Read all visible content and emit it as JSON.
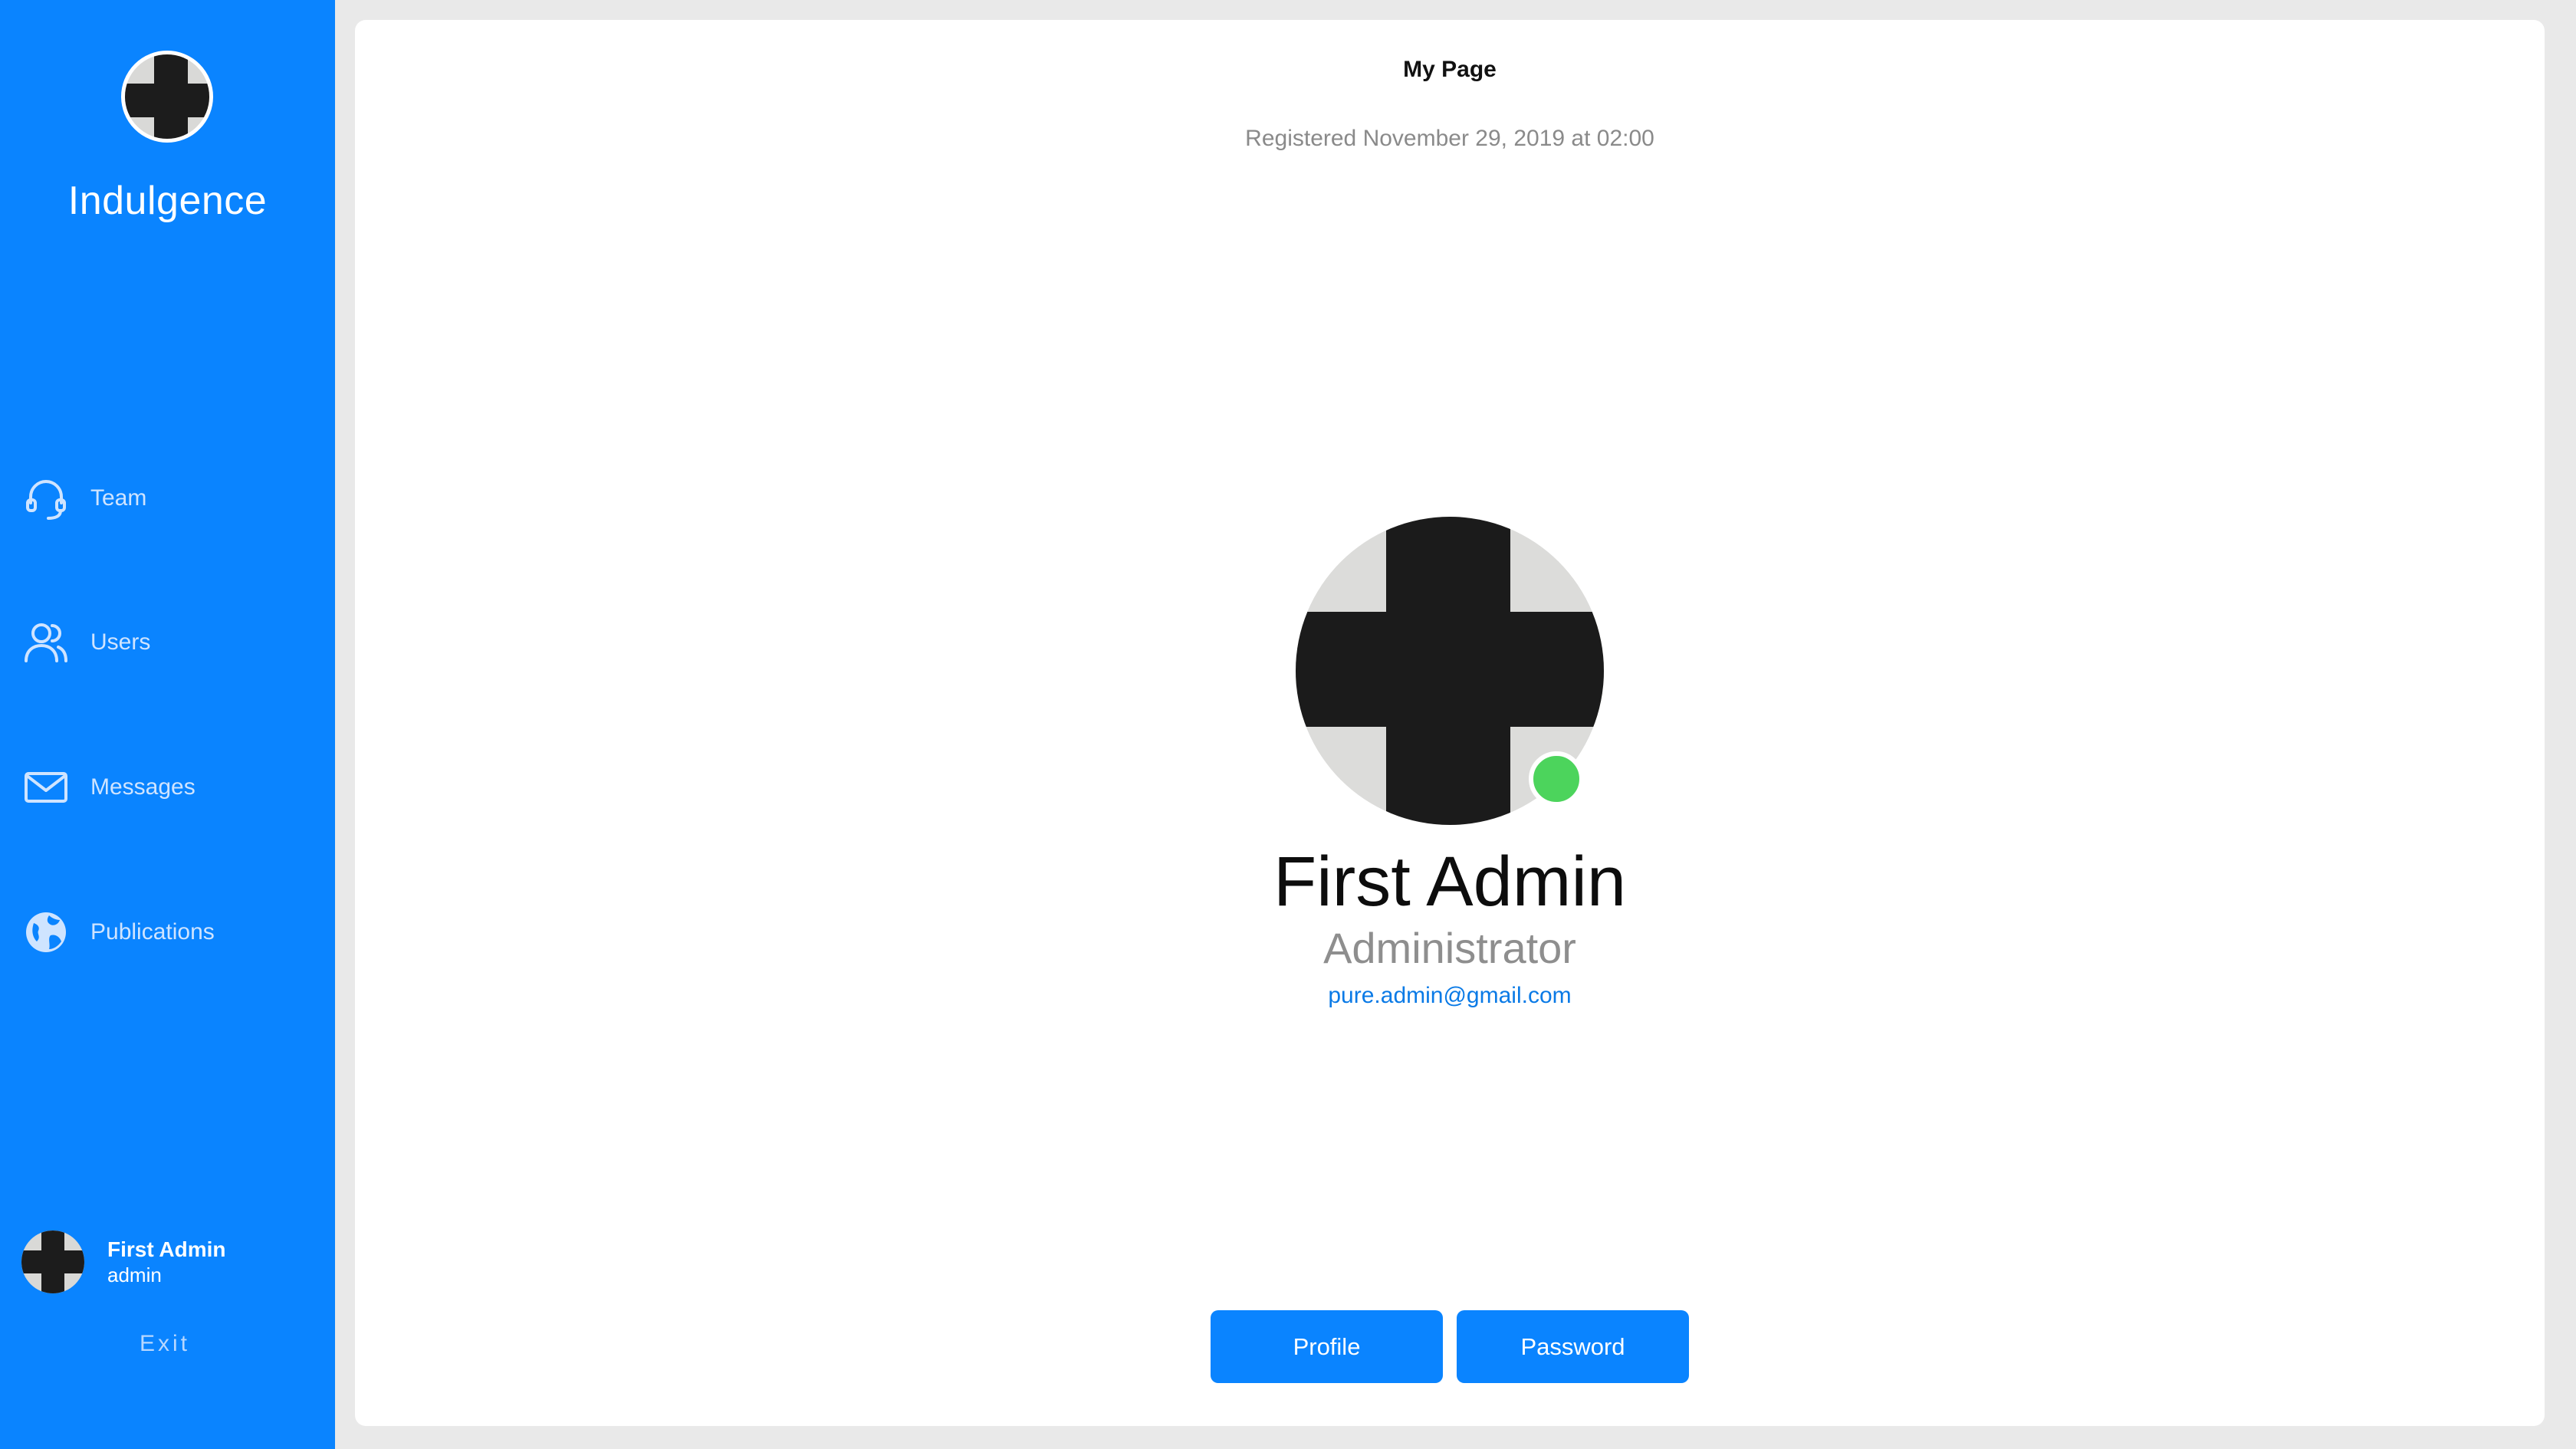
{
  "app": {
    "name": "Indulgence"
  },
  "sidebar": {
    "items": [
      {
        "label": "Team",
        "icon": "headset-icon"
      },
      {
        "label": "Users",
        "icon": "users-icon"
      },
      {
        "label": "Messages",
        "icon": "envelope-icon"
      },
      {
        "label": "Publications",
        "icon": "globe-icon"
      }
    ],
    "user": {
      "name": "First Admin",
      "login": "admin"
    },
    "exit_label": "Exit"
  },
  "main": {
    "title": "My Page",
    "registered": "Registered November 29, 2019 at 02:00",
    "profile": {
      "name": "First Admin",
      "role": "Administrator",
      "email": "pure.admin@gmail.com",
      "status": "online"
    },
    "buttons": {
      "profile": "Profile",
      "password": "Password"
    }
  },
  "colors": {
    "sidebar_bg": "#0a84ff",
    "accent": "#0a84ff",
    "status_online": "#4cd45c",
    "link": "#0a7ae6"
  }
}
